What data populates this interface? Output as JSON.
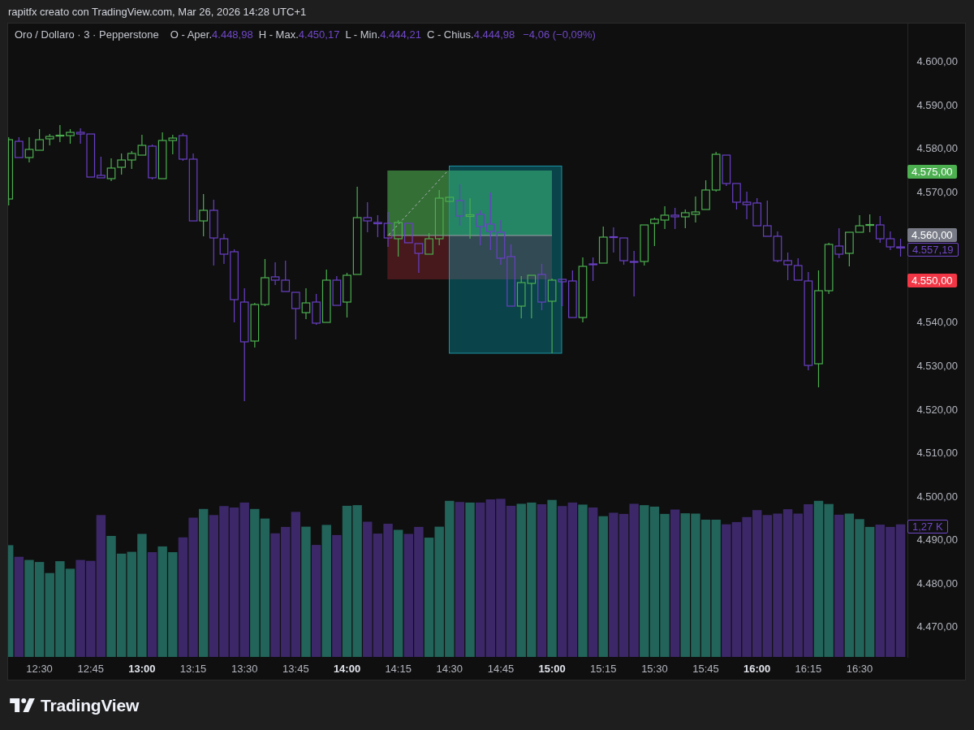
{
  "header": {
    "text": "rapitfx creato con TradingView.com, Mar 26, 2026 14:28 UTC+1"
  },
  "chart": {
    "legend": {
      "symbol": "Oro / Dollaro · 3 · Pepperstone",
      "fields": [
        {
          "label": "O - Aper.",
          "value": "4.448,98"
        },
        {
          "label": "H - Max.",
          "value": "4.450,17"
        },
        {
          "label": "L - Min.",
          "value": "4.444,21"
        },
        {
          "label": "C - Chius.",
          "value": "4.444,98"
        }
      ],
      "change": "−4,06 (−0,09%)"
    },
    "chart_data": {
      "type": "candlestick",
      "x": [
        741,
        744,
        747,
        750,
        753,
        756,
        759,
        762,
        765,
        768,
        771,
        774,
        777,
        780,
        783,
        786,
        789,
        792,
        795,
        798,
        801,
        804,
        807,
        810,
        813,
        816,
        819,
        822,
        825,
        828,
        831,
        834,
        837,
        840,
        843,
        846,
        849,
        852,
        855,
        858,
        861,
        864,
        867,
        870,
        873,
        876,
        879,
        882,
        885,
        888,
        891,
        894,
        897,
        900,
        903,
        906,
        909,
        912,
        915,
        918,
        921,
        924,
        927,
        930,
        933,
        936,
        939,
        942,
        945,
        948,
        951,
        954,
        957,
        960,
        963,
        966,
        969,
        972,
        975,
        978,
        981,
        984,
        987,
        990,
        993,
        996,
        999,
        1002
      ],
      "ohlc": [
        [
          4568.45,
          4582.64,
          4566.96,
          4582.08
        ],
        [
          4581.7,
          4582.64,
          4577.79,
          4577.97
        ],
        [
          4577.97,
          4582.64,
          4576.85,
          4579.84
        ],
        [
          4579.65,
          4584.5,
          4579.47,
          4582.08
        ],
        [
          4582.27,
          4583.38,
          4580.77,
          4582.82
        ],
        [
          4582.92,
          4585.44,
          4581.52,
          4583.1
        ],
        [
          4583.01,
          4584.5,
          4581.15,
          4583.76
        ],
        [
          4583.76,
          4584.69,
          4581.15,
          4583.38
        ],
        [
          4583.38,
          4583.57,
          4573.31,
          4573.49
        ],
        [
          4573.87,
          4578.16,
          4573.12,
          4573.31
        ],
        [
          4573.12,
          4577.79,
          4572.56,
          4575.55
        ],
        [
          4575.73,
          4578.91,
          4574.05,
          4577.41
        ],
        [
          4577.41,
          4579.47,
          4575.36,
          4578.91
        ],
        [
          4578.53,
          4583.2,
          4578.35,
          4580.77
        ],
        [
          4580.59,
          4580.96,
          4572.93,
          4573.31
        ],
        [
          4573.12,
          4583.76,
          4572.93,
          4581.89
        ],
        [
          4581.89,
          4583.2,
          4578.72,
          4582.45
        ],
        [
          4583.01,
          4583.57,
          4577.23,
          4577.6
        ],
        [
          4577.6,
          4578.91,
          4563.23,
          4563.41
        ],
        [
          4563.41,
          4569.57,
          4559.87,
          4565.84
        ],
        [
          4565.84,
          4568.27,
          4553.15,
          4559.49
        ],
        [
          4559.31,
          4560.43,
          4553.52,
          4555.76
        ],
        [
          4556.32,
          4556.88,
          4540.08,
          4545.31
        ],
        [
          4544.75,
          4547.92,
          4521.98,
          4535.61
        ],
        [
          4535.79,
          4544.56,
          4534.3,
          4544.19
        ],
        [
          4544.19,
          4554.64,
          4543.82,
          4550.35
        ],
        [
          4550.54,
          4553.9,
          4548.67,
          4549.79
        ],
        [
          4549.79,
          4554.27,
          4546.99,
          4547.18
        ],
        [
          4546.99,
          4546.99,
          4536.16,
          4543.26
        ],
        [
          4542.32,
          4547.92,
          4540.83,
          4544.56
        ],
        [
          4544.75,
          4546.62,
          4539.52,
          4539.9
        ],
        [
          4540.08,
          4552.22,
          4539.9,
          4549.79
        ],
        [
          4549.79,
          4550.72,
          4543.82,
          4544.0
        ],
        [
          4544.75,
          4551.47,
          4541.2,
          4550.91
        ],
        [
          4551.1,
          4571.25,
          4550.91,
          4564.16
        ],
        [
          4564.16,
          4567.71,
          4560.8,
          4563.41
        ],
        [
          4563.04,
          4564.72,
          4559.68,
          4562.76
        ],
        [
          4562.85,
          4565.47,
          4557.44,
          4559.49
        ],
        [
          4559.31,
          4563.6,
          4555.2,
          4563.04
        ],
        [
          4562.85,
          4563.04,
          4558.19,
          4558.38
        ],
        [
          4558.19,
          4558.19,
          4551.47,
          4555.95
        ],
        [
          4555.76,
          4560.61,
          4555.58,
          4559.31
        ],
        [
          4559.31,
          4570.51,
          4557.82,
          4568.64
        ],
        [
          4567.89,
          4568.83,
          4567.71,
          4568.83
        ],
        [
          4568.08,
          4571.81,
          4562.29,
          4564.53
        ],
        [
          4564.44,
          4568.64,
          4559.31,
          4564.81
        ],
        [
          4564.91,
          4565.84,
          4557.82,
          4562.11
        ],
        [
          4562.67,
          4569.95,
          4556.7,
          4560.99
        ],
        [
          4560.8,
          4563.6,
          4553.34,
          4554.83
        ],
        [
          4555.2,
          4558.0,
          4543.63,
          4543.82
        ],
        [
          4543.82,
          4550.72,
          4541.02,
          4549.23
        ],
        [
          4549.04,
          4551.1,
          4541.02,
          4550.91
        ],
        [
          4551.1,
          4553.52,
          4542.88,
          4544.75
        ],
        [
          4544.94,
          4550.16,
          4532.99,
          4549.79
        ],
        [
          4549.98,
          4549.98,
          4543.82,
          4549.42
        ],
        [
          4549.6,
          4552.03,
          4541.02,
          4541.2
        ],
        [
          4541.2,
          4555.02,
          4540.08,
          4552.96
        ],
        [
          4553.52,
          4555.02,
          4549.6,
          4553.34
        ],
        [
          4553.71,
          4562.11,
          4553.52,
          4559.68
        ],
        [
          4559.77,
          4561.92,
          4556.14,
          4559.59
        ],
        [
          4559.49,
          4559.68,
          4553.34,
          4554.27
        ],
        [
          4554.08,
          4556.51,
          4546.06,
          4553.9
        ],
        [
          4554.08,
          4562.67,
          4553.15,
          4562.48
        ],
        [
          4562.85,
          4564.16,
          4557.63,
          4563.79
        ],
        [
          4563.6,
          4566.77,
          4561.55,
          4564.72
        ],
        [
          4564.72,
          4566.4,
          4561.55,
          4564.35
        ],
        [
          4564.35,
          4566.03,
          4561.73,
          4565.28
        ],
        [
          4564.91,
          4569.01,
          4563.04,
          4565.47
        ],
        [
          4566.03,
          4572.75,
          4565.84,
          4570.51
        ],
        [
          4570.51,
          4579.28,
          4570.13,
          4578.72
        ],
        [
          4578.53,
          4578.72,
          4571.44,
          4572.0
        ],
        [
          4572.0,
          4572.0,
          4566.03,
          4567.71
        ],
        [
          4567.71,
          4570.13,
          4563.79,
          4567.15
        ],
        [
          4567.52,
          4568.64,
          4562.11,
          4562.29
        ],
        [
          4562.29,
          4568.08,
          4559.68,
          4559.87
        ],
        [
          4559.87,
          4560.99,
          4553.9,
          4554.27
        ],
        [
          4554.27,
          4556.14,
          4549.79,
          4553.34
        ],
        [
          4553.15,
          4554.83,
          4549.6,
          4549.79
        ],
        [
          4549.6,
          4551.66,
          4529.07,
          4530.19
        ],
        [
          4530.57,
          4552.03,
          4525.15,
          4547.36
        ],
        [
          4547.36,
          4558.38,
          4546.62,
          4558.0
        ],
        [
          4557.63,
          4561.73,
          4554.83,
          4555.76
        ],
        [
          4555.95,
          4560.8,
          4552.96,
          4560.8
        ],
        [
          4560.8,
          4564.72,
          4560.61,
          4562.29
        ],
        [
          4562.39,
          4564.91,
          4560.8,
          4562.57
        ],
        [
          4562.48,
          4564.53,
          4558.38,
          4559.31
        ],
        [
          4559.31,
          4560.99,
          4556.7,
          4557.44
        ],
        [
          4557.44,
          4559.31,
          4555.2,
          4557.19
        ]
      ],
      "xlim": [
        740.83,
        1004.01
      ],
      "ylim": [
        4463.0,
        4608.77
      ],
      "xticks": [
        {
          "value": 750,
          "label": "12:30"
        },
        {
          "value": 765,
          "label": "12:45"
        },
        {
          "value": 780,
          "label": "13:00"
        },
        {
          "value": 795,
          "label": "13:15"
        },
        {
          "value": 810,
          "label": "13:30"
        },
        {
          "value": 825,
          "label": "13:45"
        },
        {
          "value": 840,
          "label": "14:00"
        },
        {
          "value": 855,
          "label": "14:15"
        },
        {
          "value": 870,
          "label": "14:30"
        },
        {
          "value": 885,
          "label": "14:45"
        },
        {
          "value": 900,
          "label": "15:00"
        },
        {
          "value": 915,
          "label": "15:15"
        },
        {
          "value": 930,
          "label": "15:30"
        },
        {
          "value": 945,
          "label": "15:45"
        },
        {
          "value": 960,
          "label": "16:00"
        },
        {
          "value": 975,
          "label": "16:15"
        },
        {
          "value": 990,
          "label": "16:30"
        }
      ],
      "yticks": [
        {
          "value": 4600,
          "label": "4.600,00"
        },
        {
          "value": 4590,
          "label": "4.590,00"
        },
        {
          "value": 4580,
          "label": "4.580,00"
        },
        {
          "value": 4570,
          "label": "4.570,00"
        },
        {
          "value": 4540,
          "label": "4.540,00"
        },
        {
          "value": 4530,
          "label": "4.530,00"
        },
        {
          "value": 4520,
          "label": "4.520,00"
        },
        {
          "value": 4510,
          "label": "4.510,00"
        },
        {
          "value": 4500,
          "label": "4.500,00"
        },
        {
          "value": 4490,
          "label": "4.490,00"
        },
        {
          "value": 4480,
          "label": "4.480,00"
        },
        {
          "value": 4470,
          "label": "4.470,00"
        }
      ]
    },
    "price_badges": [
      {
        "text": "4.575,00",
        "kind": "filled",
        "color": "#4caf50"
      },
      {
        "text": "4.560,00",
        "kind": "filled",
        "color": "#787b86"
      },
      {
        "text": "4.557,19",
        "kind": "outlined",
        "color": "#7048c8"
      },
      {
        "text": "4.550,00",
        "kind": "filled",
        "color": "#f23645"
      },
      {
        "text": "1,27 K",
        "kind": "outlined",
        "color": "#7048c8"
      }
    ]
  },
  "time_axis": {
    "labels": [
      {
        "major": false
      },
      {
        "major": false
      },
      {
        "major": true
      },
      {
        "major": false
      },
      {
        "major": false
      },
      {
        "major": false
      },
      {
        "major": true
      },
      {
        "major": false
      },
      {
        "major": false
      },
      {
        "major": false
      },
      {
        "major": true
      },
      {
        "major": false
      },
      {
        "major": false
      },
      {
        "major": false
      },
      {
        "major": true
      },
      {
        "major": false
      },
      {
        "major": false
      }
    ]
  },
  "footer": {
    "brand": "TradingView"
  }
}
